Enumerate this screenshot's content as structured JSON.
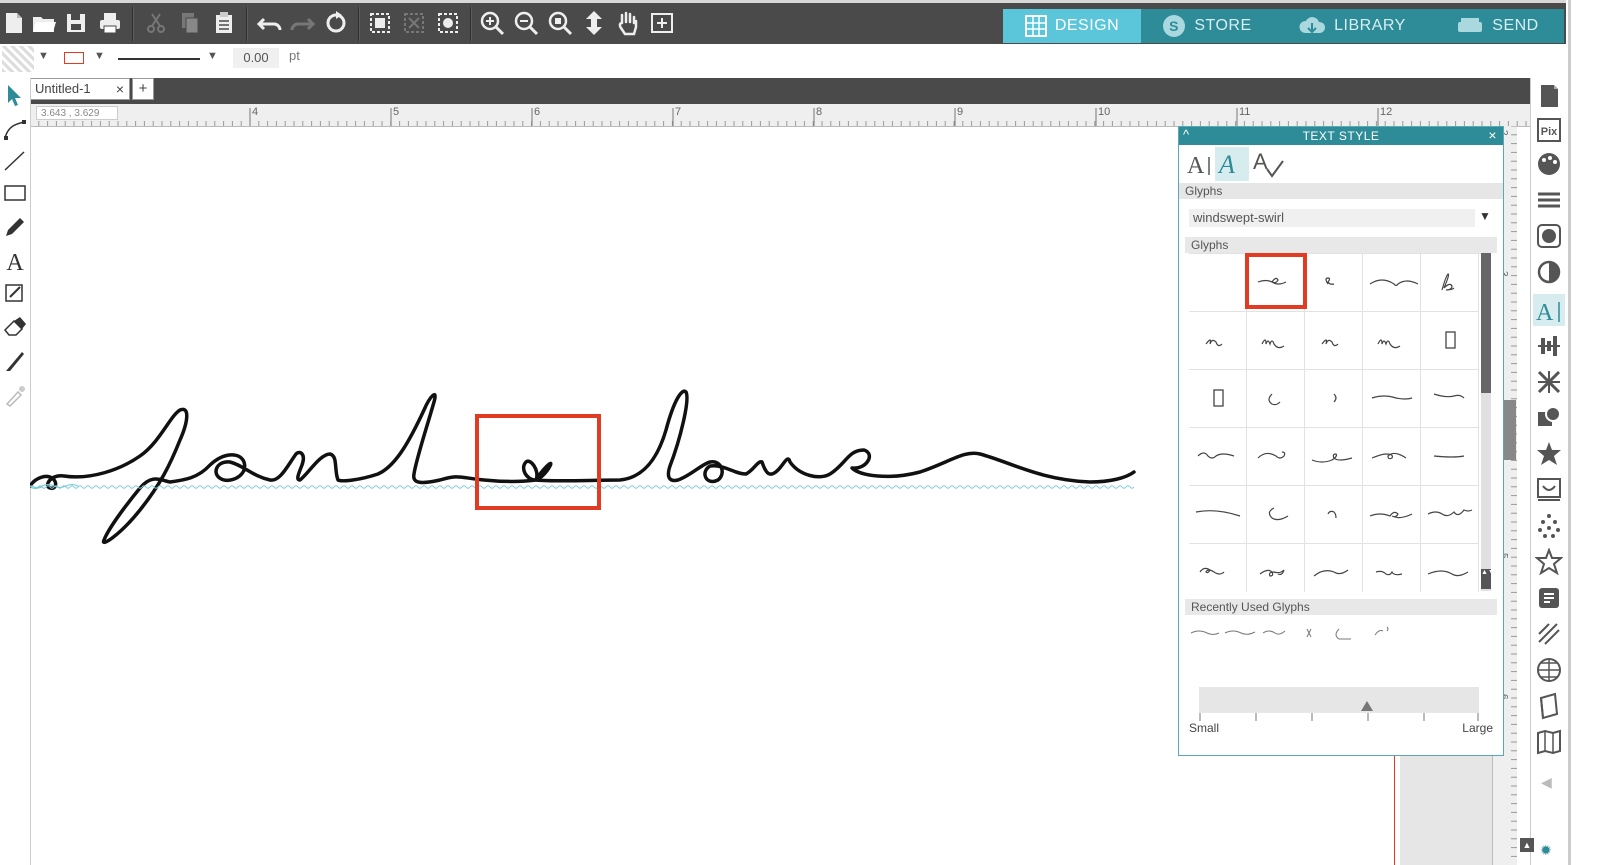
{
  "nav": {
    "design": "DESIGN",
    "store": "STORE",
    "library": "LIBRARY",
    "send": "SEND"
  },
  "propbar": {
    "line_weight": "0.00",
    "unit": "pt"
  },
  "document": {
    "tab_title": "Untitled-1",
    "close_glyph": "×",
    "add_glyph": "+",
    "coords": "3.643 , 3.629"
  },
  "ruler": {
    "h_ticks": [
      "4",
      "5",
      "6",
      "7",
      "8",
      "9",
      "10",
      "11",
      "12"
    ],
    "v_ticks": [
      "2",
      "3",
      "4",
      "5",
      "6"
    ]
  },
  "panel": {
    "title": "TEXT STYLE",
    "close_glyph": "×",
    "collapse_glyph": "^",
    "section_glyphs": "Glyphs",
    "font_select": "windswept-swirl",
    "grid_header": "Glyphs",
    "recent_header": "Recently Used Glyphs",
    "size_small": "Small",
    "size_large": "Large",
    "size_level": 0.6
  },
  "canvas": {
    "text": "font love"
  },
  "colors": {
    "accent": "#5bc6d9",
    "dark": "#4a4a4a",
    "highlight": "#e23b24",
    "panel_head": "#2e8b98"
  }
}
